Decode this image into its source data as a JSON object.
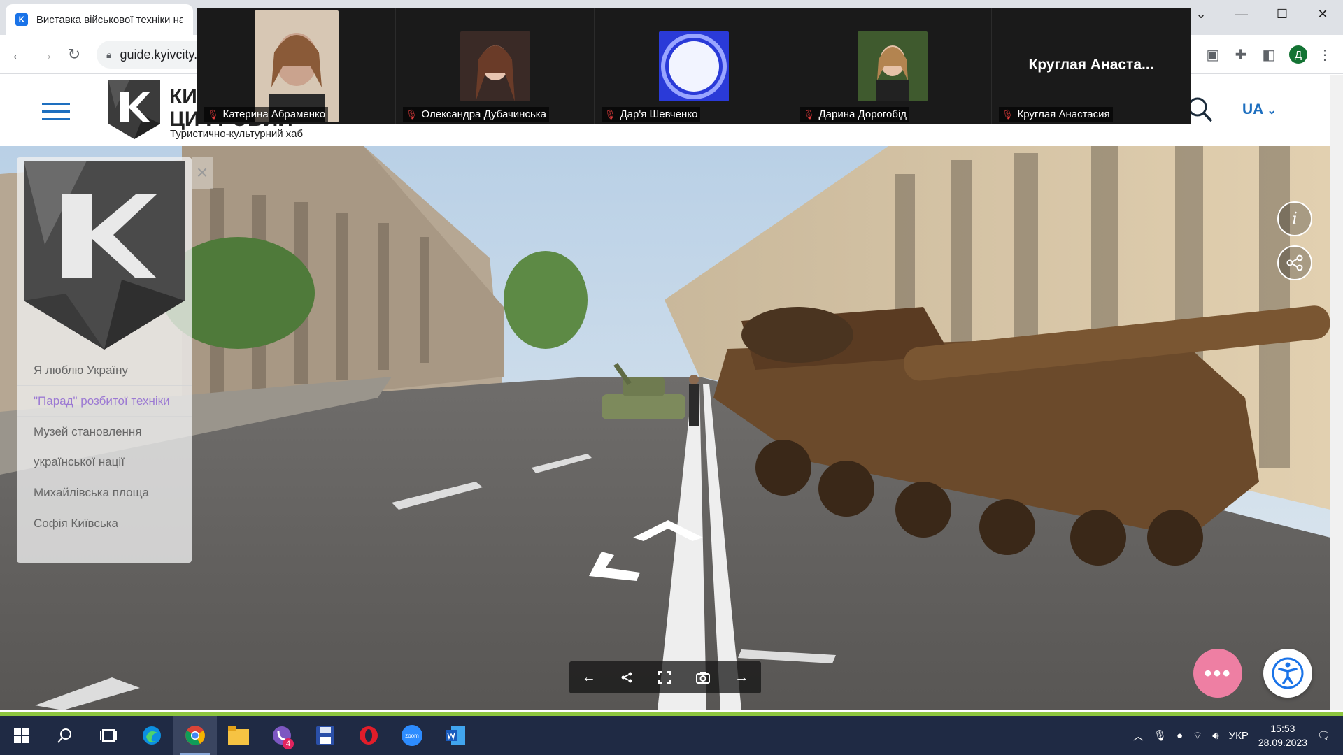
{
  "browser": {
    "tab_title": "Виставка військової техніки на",
    "url": "guide.kyivcity.",
    "profile_initial": "Д"
  },
  "site": {
    "brand_line1": "КИЇВ",
    "brand_line2": "ЦИФРОВИЙ",
    "tagline": "Туристично-культурний хаб",
    "lang": "UA"
  },
  "sidebar": {
    "close": "×",
    "items": [
      {
        "label": "Я люблю Україну",
        "active": false
      },
      {
        "label": "\"Парад\" розбитої техніки",
        "active": true
      },
      {
        "label": "Музей становлення української нації",
        "active": false
      },
      {
        "label": "Михайлівська площа",
        "active": false
      },
      {
        "label": "Софія Київська",
        "active": false
      }
    ]
  },
  "zoom": {
    "participants": [
      {
        "name": "Катерина Абраменко",
        "avatar_color": "#caa38e"
      },
      {
        "name": "Олександра Дубачинська",
        "avatar_color": "#4a3430"
      },
      {
        "name": "Дар'я Шевченко",
        "avatar_color": "#7e8fe8"
      },
      {
        "name": "Дарина Дорогобід",
        "avatar_color": "#4d6b3a"
      },
      {
        "name": "Круглая Анастасия",
        "display": "Круглая  Анаста..."
      }
    ]
  },
  "pano_controls": {
    "info": "i",
    "share": "share-icon"
  },
  "toolbar": {
    "back": "←",
    "share": "share",
    "fullscreen": "fullscreen",
    "camera": "camera",
    "forward": "→"
  },
  "taskbar": {
    "lang": "УКР",
    "time": "15:53",
    "date": "28.09.2023",
    "viber_badge": "4",
    "zoom_label": "zoom"
  }
}
